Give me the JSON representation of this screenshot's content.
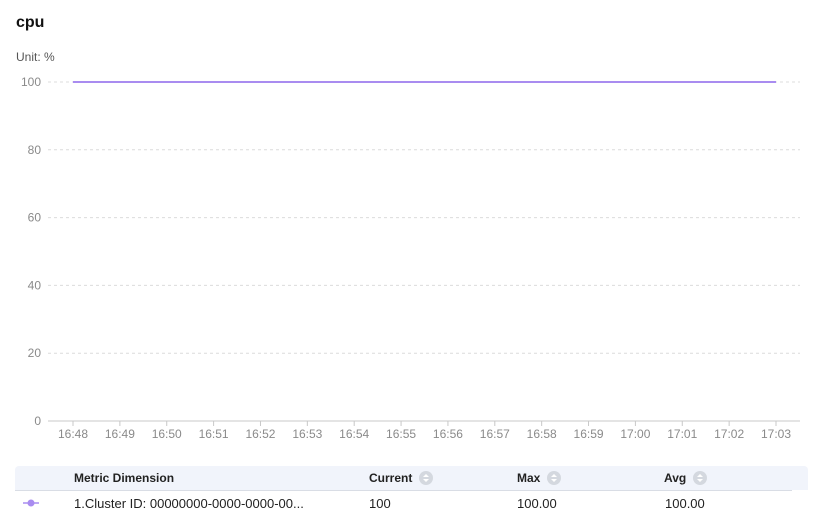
{
  "header": {
    "title": "cpu",
    "unit_label": "Unit: %"
  },
  "chart_data": {
    "type": "line",
    "x": [
      "16:48",
      "16:49",
      "16:50",
      "16:51",
      "16:52",
      "16:53",
      "16:54",
      "16:55",
      "16:56",
      "16:57",
      "16:58",
      "16:59",
      "17:00",
      "17:01",
      "17:02",
      "17:03"
    ],
    "series": [
      {
        "values": [
          100,
          100,
          100,
          100,
          100,
          100,
          100,
          100,
          100,
          100,
          100,
          100,
          100,
          100,
          100,
          100
        ],
        "color": "#a98cf0"
      }
    ],
    "y_ticks": [
      0,
      20,
      40,
      60,
      80,
      100
    ],
    "ylim": [
      0,
      100
    ],
    "grid": true
  },
  "legend_table": {
    "columns": {
      "dimension": "Metric Dimension",
      "current": "Current",
      "max": "Max",
      "avg": "Avg"
    },
    "rows": [
      {
        "dimension": "1.Cluster ID: 00000000-0000-0000-00...",
        "current": "100",
        "max": "100.00",
        "avg": "100.00"
      }
    ]
  }
}
